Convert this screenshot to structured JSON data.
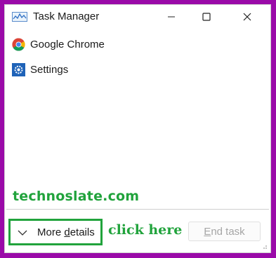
{
  "window": {
    "title": "Task Manager",
    "app_icon": "task-manager-graph-icon"
  },
  "controls": {
    "minimize_icon": "minimize-icon",
    "maximize_icon": "maximize-icon",
    "close_icon": "close-icon"
  },
  "processes": [
    {
      "label": "Google Chrome",
      "icon": "chrome-icon"
    },
    {
      "label": "Settings",
      "icon": "settings-gear-icon"
    }
  ],
  "watermark": "technoslate.com",
  "footer": {
    "more_details_prefix": "More ",
    "more_details_underlined": "d",
    "more_details_suffix": "etails",
    "annotation": "click here",
    "end_task_underlined": "E",
    "end_task_suffix": "nd task"
  },
  "colors": {
    "background_frame": "#9a0aa8",
    "annotation_green": "#21a33c",
    "disabled_text": "#a5a5a5"
  }
}
